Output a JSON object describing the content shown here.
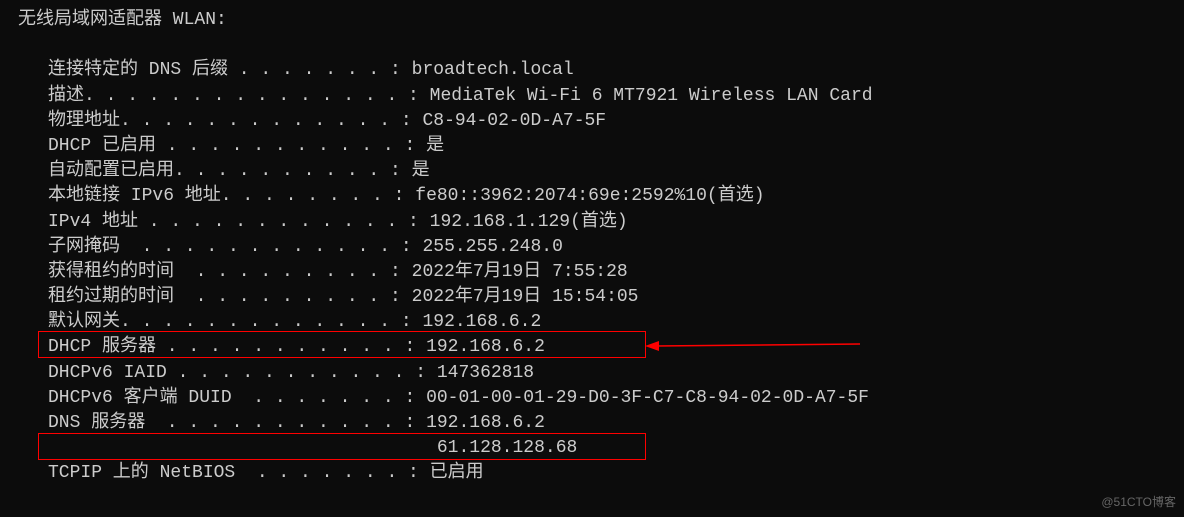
{
  "header": "无线局域网适配器 WLAN:",
  "rows": [
    {
      "label": "连接特定的 DNS 后缀 . . . . . . . :",
      "value": "broadtech.local"
    },
    {
      "label": "描述. . . . . . . . . . . . . . . :",
      "value": "MediaTek Wi-Fi 6 MT7921 Wireless LAN Card"
    },
    {
      "label": "物理地址. . . . . . . . . . . . . :",
      "value": "C8-94-02-0D-A7-5F"
    },
    {
      "label": "DHCP 已启用 . . . . . . . . . . . :",
      "value": "是"
    },
    {
      "label": "自动配置已启用. . . . . . . . . . :",
      "value": "是"
    },
    {
      "label": "本地链接 IPv6 地址. . . . . . . . :",
      "value": "fe80::3962:2074:69e:2592%10(首选)"
    },
    {
      "label": "IPv4 地址 . . . . . . . . . . . . :",
      "value": "192.168.1.129(首选)"
    },
    {
      "label": "子网掩码  . . . . . . . . . . . . :",
      "value": "255.255.248.0"
    },
    {
      "label": "获得租约的时间  . . . . . . . . . :",
      "value": "2022年7月19日 7:55:28"
    },
    {
      "label": "租约过期的时间  . . . . . . . . . :",
      "value": "2022年7月19日 15:54:05"
    },
    {
      "label": "默认网关. . . . . . . . . . . . . :",
      "value": "192.168.6.2"
    },
    {
      "label": "DHCP 服务器 . . . . . . . . . . . :",
      "value": "192.168.6.2"
    },
    {
      "label": "DHCPv6 IAID . . . . . . . . . . . :",
      "value": "147362818"
    },
    {
      "label": "DHCPv6 客户端 DUID  . . . . . . . :",
      "value": "00-01-00-01-29-D0-3F-C7-C8-94-02-0D-A7-5F"
    },
    {
      "label": "DNS 服务器  . . . . . . . . . . . :",
      "value": "192.168.6.2"
    },
    {
      "label": "                                   ",
      "value": "61.128.128.68"
    },
    {
      "label": "TCPIP 上的 NetBIOS  . . . . . . . :",
      "value": "已启用"
    }
  ],
  "watermark": "@51CTO博客"
}
